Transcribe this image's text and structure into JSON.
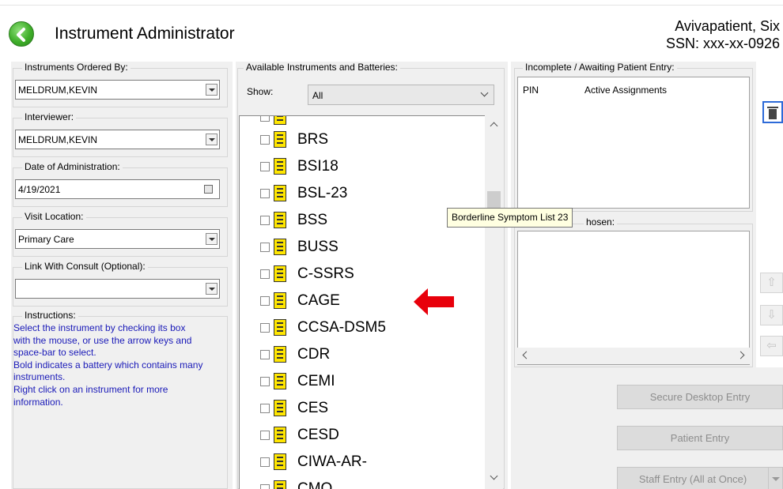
{
  "header": {
    "title": "Instrument Administrator",
    "patient_name": "Avivapatient, Six",
    "patient_ssn": "SSN: xxx-xx-0926"
  },
  "left_panel": {
    "ordered_by_label": "Instruments Ordered By:",
    "ordered_by_value": "MELDRUM,KEVIN",
    "interviewer_label": "Interviewer:",
    "interviewer_value": "MELDRUM,KEVIN",
    "date_label": "Date of Administration:",
    "date_value": "4/19/2021",
    "visit_location_label": "Visit Location:",
    "visit_location_value": "Primary Care",
    "consult_label": "Link With Consult (Optional):",
    "consult_value": "",
    "instructions_label": "Instructions:",
    "instructions": [
      "Select the instrument by checking its box",
      "with the mouse, or use the arrow keys and",
      "space-bar to select.",
      " Bold indicates a battery which contains many",
      "instruments.",
      " Right click on an instrument for more",
      "information."
    ]
  },
  "center_panel": {
    "label": "Available Instruments and Batteries:",
    "show_label": "Show:",
    "show_value": "All",
    "items": [
      "BRS",
      "BSI18",
      "BSL-23",
      "BSS",
      "BUSS",
      "C-SSRS",
      "CAGE",
      "CCSA-DSM5",
      "CDR",
      "CEMI",
      "CES",
      "CESD",
      "CIWA-AR-",
      "CMQ"
    ]
  },
  "right_panel": {
    "incomplete_label": "Incomplete / Awaiting Patient Entry:",
    "col_pin": "PIN",
    "col_active": "Active Assignments",
    "chosen_label": "hosen:",
    "tooltip": "Borderline Symptom List 23",
    "secure_entry": "Secure Desktop Entry",
    "patient_entry": "Patient Entry",
    "staff_entry": "Staff Entry (All at Once)"
  },
  "colors": {
    "instructions_text": "#1a1ab8",
    "red_arrow": "#e8000b",
    "back_green": "#3fae2a"
  }
}
